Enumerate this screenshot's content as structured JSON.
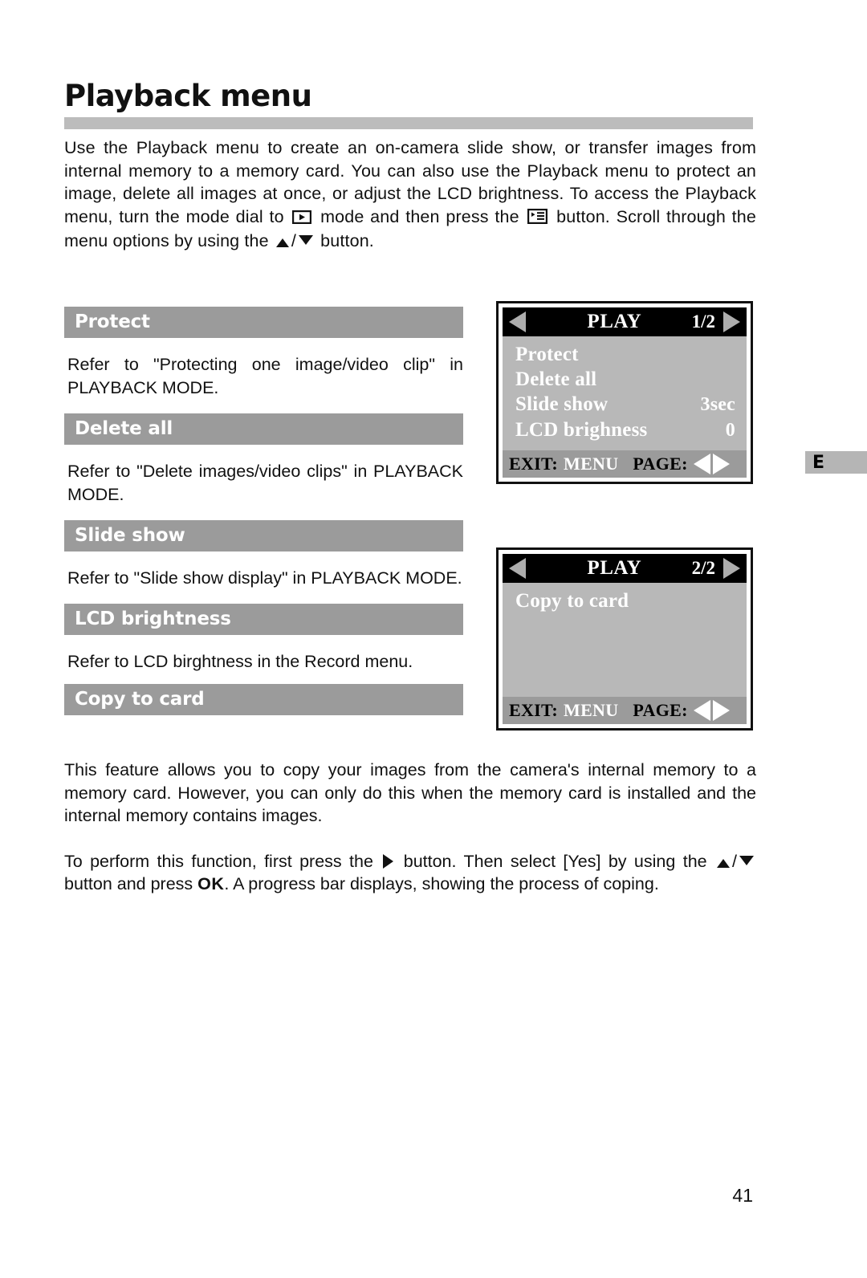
{
  "document": {
    "title": "Playback menu",
    "page_number": "41",
    "edge_tab_label": "E"
  },
  "intro": {
    "part1": "Use the Playback menu to create an on-camera slide show, or transfer images from internal memory to a memory card. You can also use the Playback menu to protect an image, delete all images at once, or adjust the LCD brightness. To access the Playback menu, turn the mode dial to",
    "part2": "mode and then press the",
    "part3": "button. Scroll through the menu options by using the",
    "part4": "/",
    "part5": "button.",
    "icons": {
      "playback_mode": "playback-mode-icon",
      "menu": "menu-icon",
      "up": "up-arrow-icon",
      "down": "down-arrow-icon"
    }
  },
  "sections": [
    {
      "header": "Protect",
      "body": "Refer to \"Protecting one image/video clip\" in PLAYBACK MODE."
    },
    {
      "header": "Delete all",
      "body": "Refer to \"Delete images/video clips\" in PLAYBACK MODE."
    },
    {
      "header": "Slide show",
      "body": "Refer to \"Slide show display\" in PLAYBACK MODE."
    },
    {
      "header": "LCD brightness",
      "body": "Refer to LCD birghtness in the Record menu."
    },
    {
      "header": "Copy to card",
      "body": ""
    }
  ],
  "bottom": {
    "paragraph1": "This feature allows you to copy your images from the camera's internal memory to a memory card. However, you can only do this when the memory card is installed and the internal memory contains images.",
    "p2_part1": "To perform this function, first press the",
    "p2_part2": "button. Then select [Yes] by using the",
    "p2_part3": "/",
    "p2_part4": "button and press",
    "p2_ok": "OK",
    "p2_part5": ". A progress bar displays, showing the process of coping."
  },
  "lcd_screens": [
    {
      "id": "play-1-2",
      "title": "PLAY",
      "page_indicator": "1/2",
      "rows": [
        {
          "label": "Protect",
          "value": ""
        },
        {
          "label": "Delete all",
          "value": ""
        },
        {
          "label": "Slide show",
          "value": "3sec"
        },
        {
          "label": "LCD brighness",
          "value": "0"
        }
      ],
      "footer": {
        "exit_label": "EXIT:",
        "exit_value": "MENU",
        "page_label": "PAGE:"
      }
    },
    {
      "id": "play-2-2",
      "title": "PLAY",
      "page_indicator": "2/2",
      "rows": [
        {
          "label": "Copy to card",
          "value": ""
        },
        {
          "label": "",
          "value": ""
        },
        {
          "label": "",
          "value": ""
        },
        {
          "label": "",
          "value": ""
        }
      ],
      "footer": {
        "exit_label": "EXIT:",
        "exit_value": "MENU",
        "page_label": "PAGE:"
      }
    }
  ],
  "colors": {
    "section_header_bg": "#9b9b9b",
    "title_rule": "#bcbcbc",
    "lcd_screen_bg": "#b8b8b8",
    "lcd_topbar_bg": "#000000",
    "lcd_footer_bg": "#9b9b9b",
    "edge_tab_bg": "#b5b5b5"
  }
}
